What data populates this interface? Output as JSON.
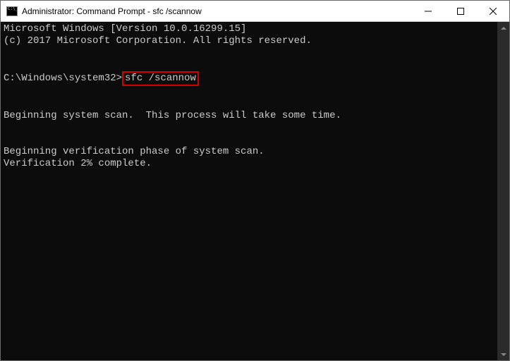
{
  "window": {
    "title": "Administrator: Command Prompt - sfc  /scannow"
  },
  "console": {
    "header_line1": "Microsoft Windows [Version 10.0.16299.15]",
    "header_line2": "(c) 2017 Microsoft Corporation. All rights reserved.",
    "prompt": "C:\\Windows\\system32>",
    "command": "sfc /scannow",
    "msg_scan_start": "Beginning system scan.  This process will take some time.",
    "msg_verify_phase": "Beginning verification phase of system scan.",
    "msg_progress": "Verification 2% complete."
  }
}
